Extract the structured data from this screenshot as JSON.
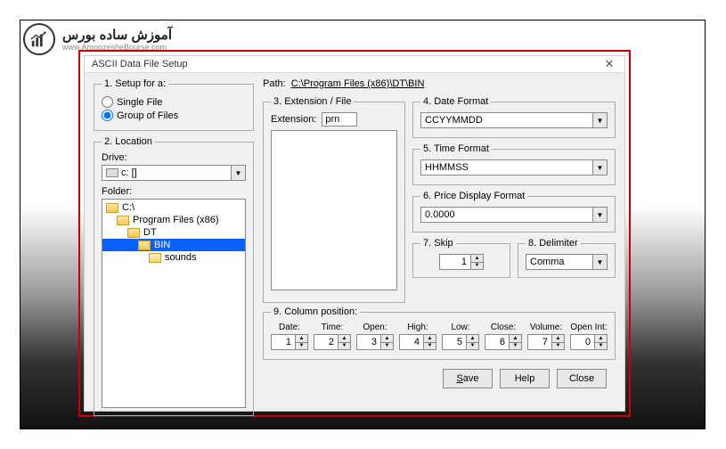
{
  "brand": {
    "title": "آموزش ساده بورس",
    "url": "www.AmoozesheBourse.com"
  },
  "dialog": {
    "title": "ASCII Data File Setup",
    "setup_for": {
      "legend": "1. Setup for a:",
      "single": "Single File",
      "group": "Group of Files",
      "selected": "group"
    },
    "location": {
      "legend": "2. Location",
      "drive_label": "Drive:",
      "drive_value": "c: []",
      "folder_label": "Folder:",
      "tree": [
        {
          "label": "C:\\",
          "depth": 0,
          "open": true,
          "sel": false
        },
        {
          "label": "Program Files (x86)",
          "depth": 1,
          "open": true,
          "sel": false
        },
        {
          "label": "DT",
          "depth": 2,
          "open": true,
          "sel": false
        },
        {
          "label": "BIN",
          "depth": 3,
          "open": true,
          "sel": true
        },
        {
          "label": "sounds",
          "depth": 4,
          "open": false,
          "sel": false
        }
      ]
    },
    "path_label": "Path:",
    "path_value": "C:\\Program Files (x86)\\DT\\BIN",
    "extension": {
      "legend": "3. Extension / File",
      "label": "Extension:",
      "value": "prn"
    },
    "date_format": {
      "legend": "4. Date Format",
      "value": "CCYYMMDD"
    },
    "time_format": {
      "legend": "5. Time Format",
      "value": "HHMMSS"
    },
    "price_format": {
      "legend": "6. Price Display Format",
      "value": "0.0000"
    },
    "skip": {
      "legend": "7. Skip",
      "value": "1"
    },
    "delimiter": {
      "legend": "8. Delimiter",
      "value": "Comma"
    },
    "column_position": {
      "legend": "9. Column position:",
      "cols": [
        {
          "label": "Date:",
          "value": "1"
        },
        {
          "label": "Time:",
          "value": "2"
        },
        {
          "label": "Open:",
          "value": "3"
        },
        {
          "label": "High:",
          "value": "4"
        },
        {
          "label": "Low:",
          "value": "5"
        },
        {
          "label": "Close:",
          "value": "6"
        },
        {
          "label": "Volume:",
          "value": "7"
        },
        {
          "label": "Open Int:",
          "value": "0"
        }
      ]
    },
    "buttons": {
      "save": "Save",
      "help": "Help",
      "close": "Close"
    }
  }
}
